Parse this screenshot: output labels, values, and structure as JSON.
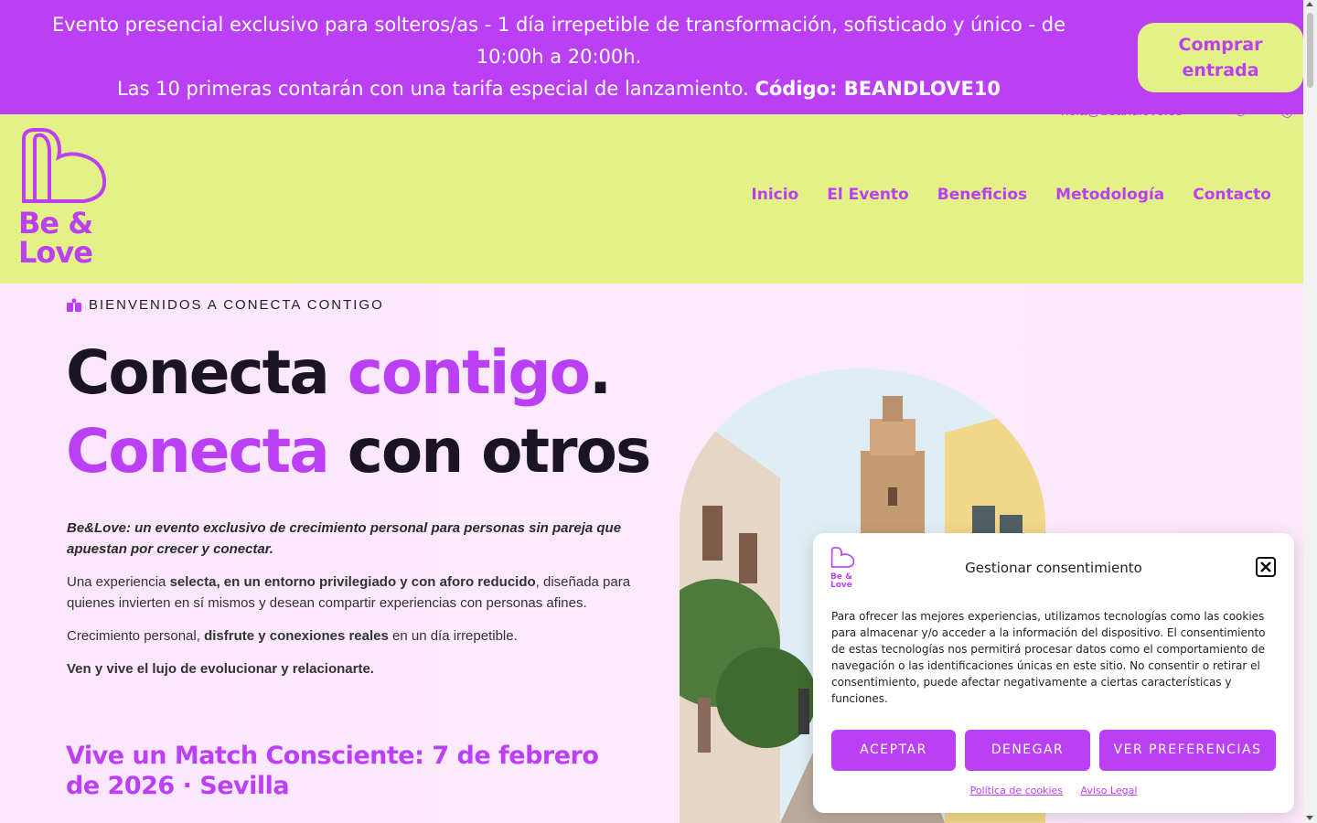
{
  "promo": {
    "line1": "Evento presencial exclusivo para solteros/as - 1 día irrepetible de transformación, sofisticado y único - de 10:00h a 20:00h.",
    "line2_prefix": "Las 10 primeras contarán con una tarifa especial de lanzamiento. ",
    "line2_code": "Código: BEANDLOVE10",
    "cta": "Comprar entrada"
  },
  "header": {
    "contact_email": "hola@beandlove.es",
    "logo_text_line1": "Be &",
    "logo_text_line2": "Love",
    "nav": [
      {
        "label": "Inicio"
      },
      {
        "label": "El Evento"
      },
      {
        "label": "Beneficios"
      },
      {
        "label": "Metodología"
      },
      {
        "label": "Contacto"
      }
    ]
  },
  "hero": {
    "eyebrow": "BIENVENIDOS A CONECTA CONTIGO",
    "headline_line1_a": "Conecta ",
    "headline_line1_b": "contigo",
    "headline_line1_c": ".",
    "headline_line2_a": "Conecta",
    "headline_line2_b": " con otros",
    "lead": "Be&Love: un evento exclusivo de crecimiento personal para personas sin pareja que apuestan por crecer y conectar.",
    "p1_a": "Una experiencia ",
    "p1_b": "selecta, en un entorno privilegiado y con aforo reducido",
    "p1_c": ", diseñada para quienes invierten en sí mismos y desean compartir experiencias con personas afines.",
    "p2_a": "Crecimiento personal, ",
    "p2_b": "disfrute y conexiones reales",
    "p2_c": " en un día irrepetible.",
    "p3": "Ven y vive el lujo de evolucionar y relacionarte.",
    "subhead": "Vive un Match Consciente: 7 de febrero de 2026 · Sevilla"
  },
  "consent": {
    "logo_text_line1": "Be &",
    "logo_text_line2": "Love",
    "title": "Gestionar consentimiento",
    "body": "Para ofrecer las mejores experiencias, utilizamos tecnologías como las cookies para almacenar y/o acceder a la información del dispositivo. El consentimiento de estas tecnologías nos permitirá procesar datos como el comportamiento de navegación o las identificaciones únicas en este sitio. No consentir o retirar el consentimiento, puede afectar negativamente a ciertas características y funciones.",
    "accept": "ACEPTAR",
    "deny": "DENEGAR",
    "prefs": "VER PREFERENCIAS",
    "link_cookies": "Política de cookies",
    "link_legal": "Aviso Legal"
  },
  "colors": {
    "brand_purple": "#bb40f5",
    "brand_lime": "#e3f187",
    "background_pink": "#fbe6fb"
  }
}
